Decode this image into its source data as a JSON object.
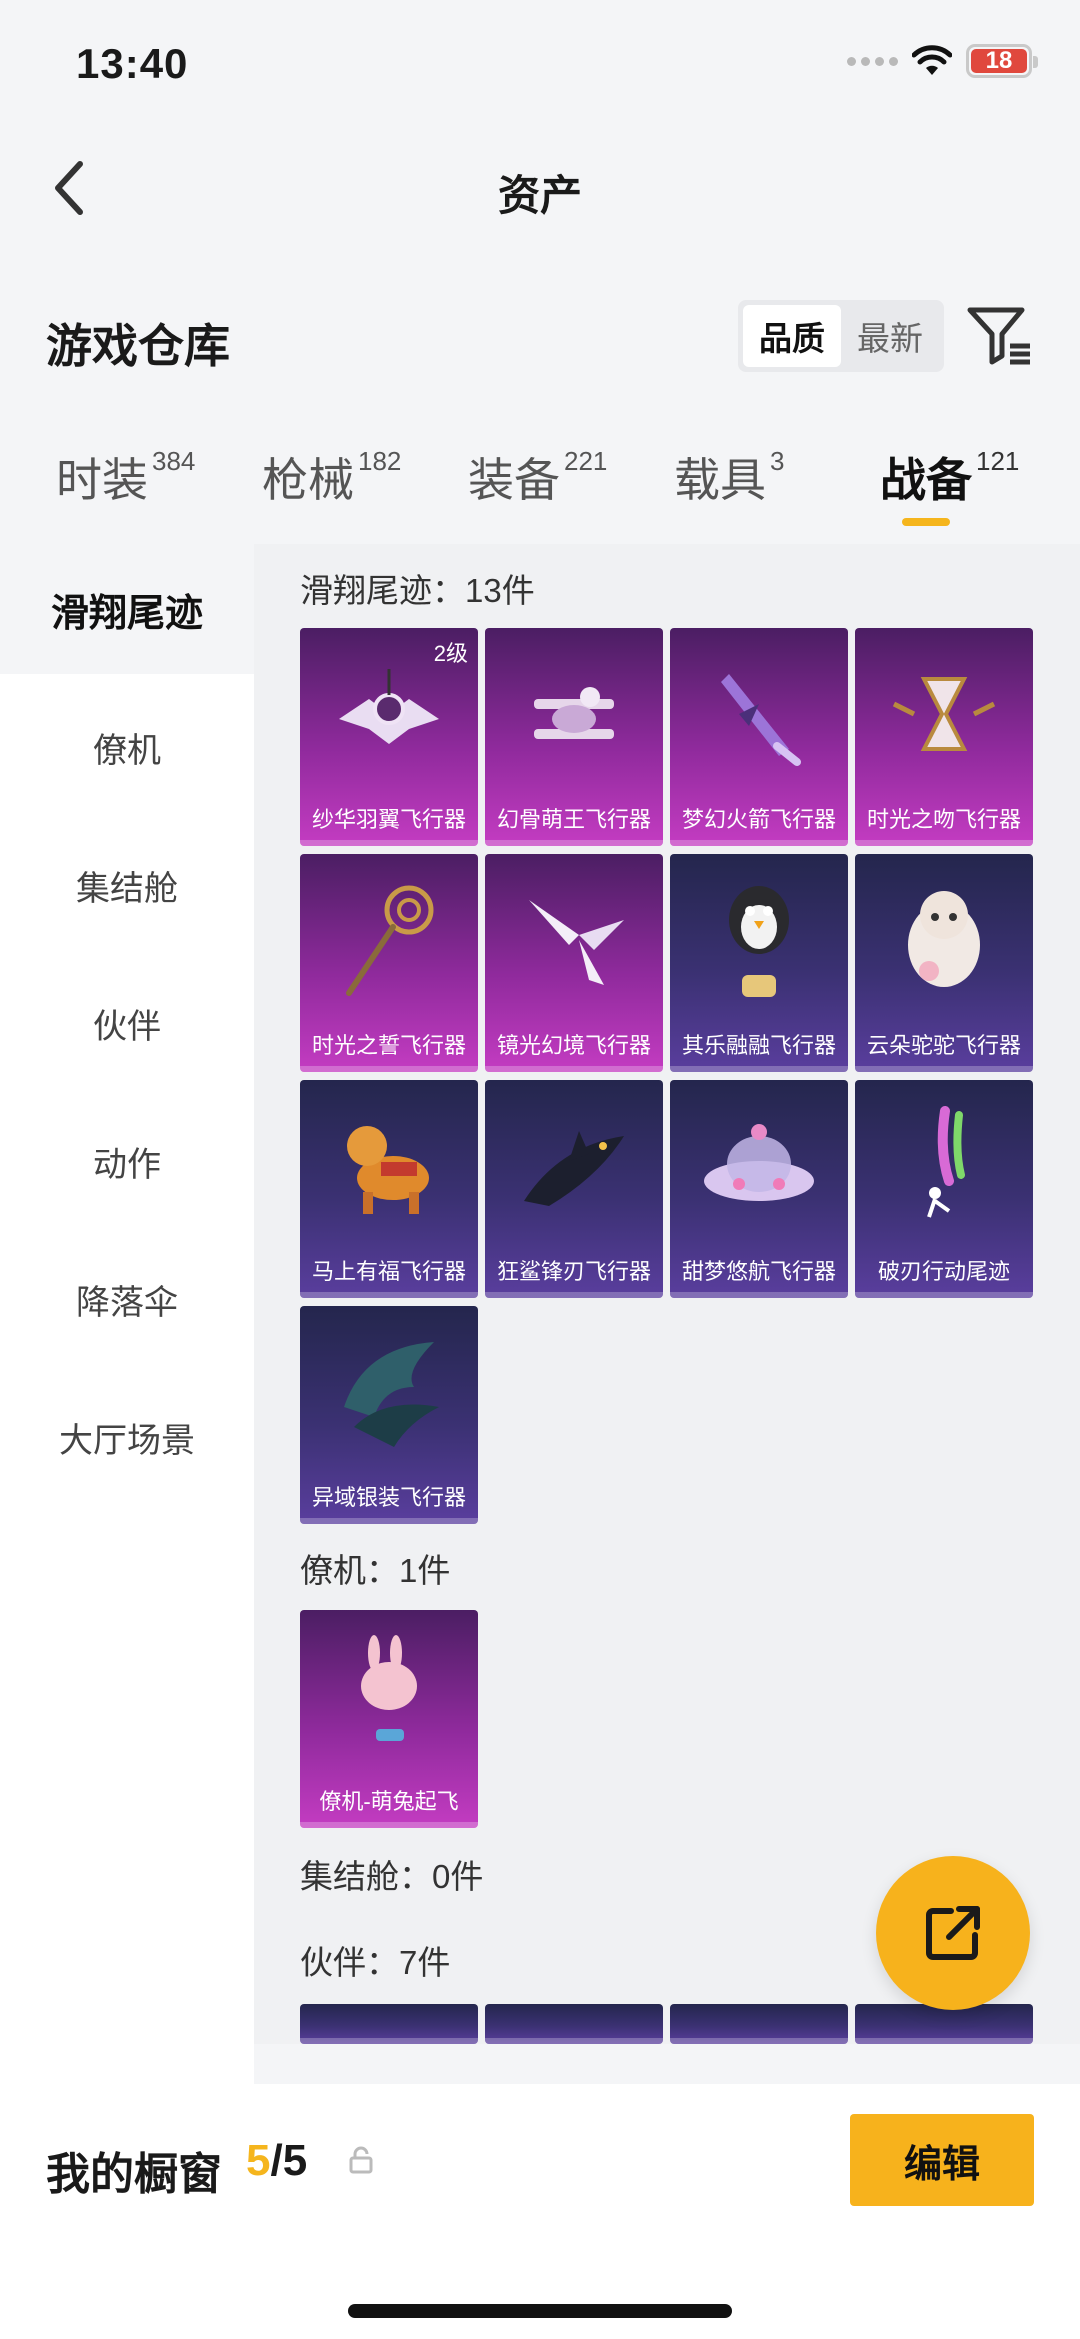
{
  "status": {
    "time": "13:40",
    "battery": "18"
  },
  "nav": {
    "title": "资产"
  },
  "warehouse": {
    "title": "游戏仓库",
    "sort_options": [
      {
        "label": "品质",
        "active": true
      },
      {
        "label": "最新",
        "active": false
      }
    ]
  },
  "tabs": [
    {
      "label": "时装",
      "count": "384"
    },
    {
      "label": "枪械",
      "count": "182"
    },
    {
      "label": "装备",
      "count": "221"
    },
    {
      "label": "载具",
      "count": "3"
    },
    {
      "label": "战备",
      "count": "121",
      "active": true
    }
  ],
  "sidebar": {
    "items": [
      {
        "label": "滑翔尾迹",
        "active": true
      },
      {
        "label": "僚机"
      },
      {
        "label": "集结舱"
      },
      {
        "label": "伙伴"
      },
      {
        "label": "动作"
      },
      {
        "label": "降落伞"
      },
      {
        "label": "大厅场景"
      }
    ]
  },
  "sections": [
    {
      "title": "滑翔尾迹：13件",
      "items": [
        {
          "name": "纱华羽翼飞行器",
          "level": "2级",
          "color": "purple",
          "icon": "winged-gadget-icon"
        },
        {
          "name": "幻骨萌王飞行器",
          "color": "purple",
          "icon": "biplane-icon"
        },
        {
          "name": "梦幻火箭飞行器",
          "color": "purple",
          "icon": "rocket-icon"
        },
        {
          "name": "时光之吻飞行器",
          "color": "purple",
          "icon": "hourglass-icon"
        },
        {
          "name": "时光之誓飞行器",
          "color": "purple",
          "icon": "scepter-icon"
        },
        {
          "name": "镜光幻境飞行器",
          "color": "purple",
          "icon": "crystal-wings-icon"
        },
        {
          "name": "其乐融融飞行器",
          "color": "blue",
          "icon": "penguin-balloon-icon"
        },
        {
          "name": "云朵驼驼飞行器",
          "color": "blue",
          "icon": "alpaca-icon"
        },
        {
          "name": "马上有福飞行器",
          "color": "blue",
          "icon": "toy-horse-icon"
        },
        {
          "name": "狂鲨锋刃飞行器",
          "color": "blue",
          "icon": "shark-icon"
        },
        {
          "name": "甜梦悠航飞行器",
          "color": "blue",
          "icon": "ufo-icon"
        },
        {
          "name": "破刃行动尾迹",
          "color": "blue",
          "icon": "smoke-trail-icon"
        },
        {
          "name": "异域银装飞行器",
          "color": "blue",
          "icon": "dark-wings-icon"
        }
      ]
    },
    {
      "title": "僚机：1件",
      "items": [
        {
          "name": "僚机-萌兔起飞",
          "color": "purple",
          "icon": "bunny-drone-icon"
        }
      ]
    },
    {
      "title": "集结舱：0件",
      "items": []
    },
    {
      "title": "伙伴：7件",
      "items": []
    }
  ],
  "showcase": {
    "label": "我的橱窗",
    "current": "5",
    "total": "/5",
    "edit_label": "编辑"
  }
}
